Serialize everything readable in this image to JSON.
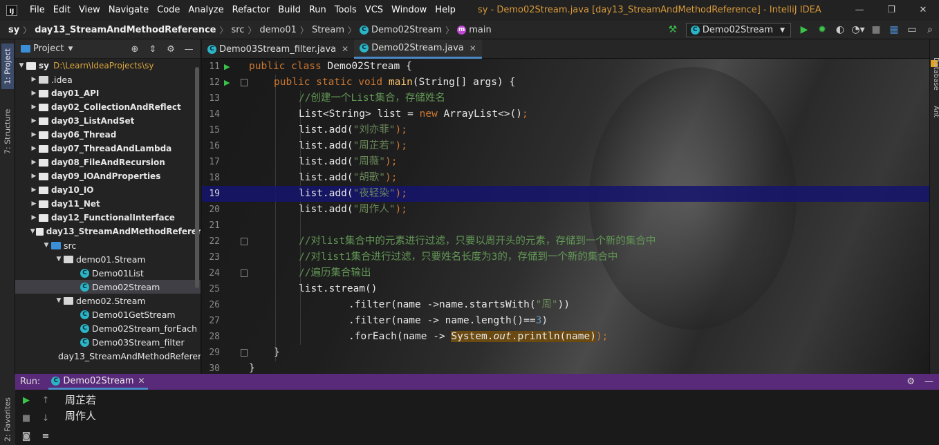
{
  "titlebar": {
    "menus": [
      "File",
      "Edit",
      "View",
      "Navigate",
      "Code",
      "Analyze",
      "Refactor",
      "Build",
      "Run",
      "Tools",
      "VCS",
      "Window",
      "Help"
    ],
    "window_title": "sy - Demo02Stream.java [day13_StreamAndMethodReference] - IntelliJ IDEA",
    "minimize": "—",
    "maximize": "❐",
    "close": "✕"
  },
  "navbar": {
    "crumbs": [
      "sy",
      "day13_StreamAndMethodReference",
      "src",
      "demo01",
      "Stream",
      "Demo02Stream",
      "main"
    ],
    "run_config": "Demo02Stream"
  },
  "left_strip": {
    "project_tab": "1: Project",
    "structure_tab": "7: Structure"
  },
  "project": {
    "title": "Project",
    "tree": [
      {
        "label": "sy",
        "path": "D:\\Learn\\IdeaProjects\\sy"
      },
      {
        "label": ".idea"
      },
      {
        "label": "day01_API"
      },
      {
        "label": "day02_CollectionAndReflect"
      },
      {
        "label": "day03_ListAndSet"
      },
      {
        "label": "day06_Thread"
      },
      {
        "label": "day07_ThreadAndLambda"
      },
      {
        "label": "day08_FileAndRecursion"
      },
      {
        "label": "day09_IOAndProperties"
      },
      {
        "label": "day10_IO"
      },
      {
        "label": "day11_Net"
      },
      {
        "label": "day12_FunctionalInterface"
      },
      {
        "label": "day13_StreamAndMethodReferer"
      },
      {
        "label": "src"
      },
      {
        "label": "demo01.Stream"
      },
      {
        "label": "Demo01List"
      },
      {
        "label": "Demo02Stream"
      },
      {
        "label": "demo02.Stream"
      },
      {
        "label": "Demo01GetStream"
      },
      {
        "label": "Demo02Stream_forEach"
      },
      {
        "label": "Demo03Stream_filter"
      },
      {
        "label": "day13_StreamAndMethodReferer"
      }
    ]
  },
  "editor": {
    "tabs": [
      "Demo03Stream_filter.java",
      "Demo02Stream.java"
    ],
    "line_numbers": [
      "11",
      "12",
      "13",
      "14",
      "15",
      "16",
      "17",
      "18",
      "19",
      "20",
      "21",
      "22",
      "23",
      "24",
      "25",
      "26",
      "27",
      "28",
      "29",
      "30"
    ],
    "code": {
      "l11": [
        "public class ",
        "Demo02Stream {"
      ],
      "l12": [
        "public static void ",
        "main",
        "(String[] args) {"
      ],
      "l13": "//创建一个List集合，存储姓名",
      "l14": [
        "List<String> list = ",
        "new ",
        "ArrayList<>()",
        ";"
      ],
      "l15": [
        "list.add(",
        "\"刘亦菲\"",
        ");"
      ],
      "l16": [
        "list.add(",
        "\"周芷若\"",
        ");"
      ],
      "l17": [
        "list.add(",
        "\"周薇\"",
        ");"
      ],
      "l18": [
        "list.add(",
        "\"胡歌\"",
        ");"
      ],
      "l19": [
        "list.add(",
        "\"夜轻染\"",
        ");"
      ],
      "l20": [
        "list.add(",
        "\"周作人\"",
        ");"
      ],
      "l22": "//对list集合中的元素进行过滤，只要以周开头的元素，存储到一个新的集合中",
      "l23": "//对list1集合进行过滤，只要姓名长度为3的，存储到一个新的集合中",
      "l24": "//遍历集合输出",
      "l25": "list.stream()",
      "l26": [
        ".filter(name ->name.startsWith(",
        "\"周\"",
        "))"
      ],
      "l27": [
        ".filter(name -> name.length()==",
        "3",
        ")"
      ],
      "l28": [
        ".forEach(name -> ",
        "System.",
        "out",
        ".println(name)",
        ");"
      ],
      "l29": "}",
      "l30": "}"
    }
  },
  "right_strip": {
    "database": "Database",
    "ant": "Ant"
  },
  "run": {
    "label": "Run:",
    "tab": "Demo02Stream",
    "output": [
      "周芷若",
      "周作人"
    ]
  },
  "favorites": "2: Favorites",
  "colors": {
    "keyword": "#cc7832",
    "string": "#6a8759",
    "comment": "#629755",
    "method": "#ffc66d",
    "run_header": "#5a2a7a",
    "accent": "#4a88c7"
  }
}
